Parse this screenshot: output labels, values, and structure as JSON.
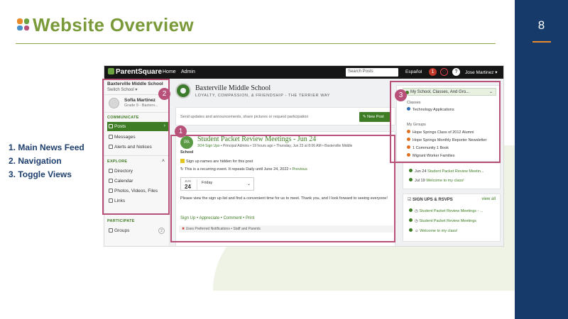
{
  "slide": {
    "title": "Website Overview",
    "page_number": "8",
    "legend": [
      "1. Main News Feed",
      "2. Navigation",
      "3. Toggle Views"
    ],
    "logo_colors": [
      "#e98a2b",
      "#6aa33f",
      "#4a90c8",
      "#b8517a"
    ],
    "accent_color": "#7a9a3a",
    "band_color": "#163b6a",
    "callout_color": "#b8517a",
    "callouts": [
      "1",
      "2",
      "3"
    ]
  },
  "app": {
    "brand": "ParentSquare",
    "nav": [
      "Home",
      "Admin"
    ],
    "search_placeholder": "Search Posts",
    "language": "Español",
    "notification_count": "1",
    "help_icon": "?",
    "user": "Jose Martinez ▾"
  },
  "sidebar": {
    "school": "Baxterville Middle School",
    "switch": "Switch School ▾",
    "student_name": "Sofia Martinez",
    "student_grade": "Grade 9 - Baxterv...",
    "communicate_label": "COMMUNICATE",
    "communicate_items": [
      "Posts",
      "Messages",
      "Alerts and Notices"
    ],
    "explore_label": "EXPLORE",
    "explore_items": [
      "Directory",
      "Calendar",
      "Photos, Videos, Files",
      "Links"
    ],
    "participate_label": "PARTICIPATE",
    "participate_items": [
      "Groups"
    ],
    "groups_count": "2",
    "collapse_icon": "˄"
  },
  "school": {
    "name": "Baxterville Middle School",
    "motto": "LOYALTY, COMPASSION, & FRIENDSHIP - THE TERRIER WAY"
  },
  "composer": {
    "placeholder": "Send updates and announcements, share pictures or request participation",
    "button": "New Post"
  },
  "post": {
    "avatar": "PA",
    "title": "Student Packet Review Meetings - Jun 24",
    "signups": "3/24 Sign Ups",
    "meta": " • Principal Admins • 19 hours ago • Thursday, Jun 23 at 8:06 AM • Baxterville Middle",
    "school": "School",
    "signup_note": "Sign up names are hidden for this post",
    "recurring": "This is a recurring event. It repeats Daily until June 24, 2022 • ",
    "previous": "Previous",
    "date_month": "JUN",
    "date_day": "24",
    "weekday": "Friday",
    "body": "Please view the sign up list and find a convenient time for us to meet. Thank you, and I look forward to seeing everyone!",
    "actions": "Sign Up • Appreciate • Comment • Print",
    "footer": "Uses Preferred Notifications • Staff and Parents"
  },
  "views": {
    "toggle": "My School, Classes, And Gro...",
    "classes_label": "Classes",
    "classes": [
      "Technology Applications"
    ],
    "groups_label": "My Groups",
    "groups": [
      "Hope Springs Class of 2012 Alumni",
      "Hope Springs Monthly Reporter Newsletter",
      "1 Community 1 Book",
      "Migrant Worker Families"
    ],
    "class_color": "#2f6db3",
    "group_color": "#e07020"
  },
  "events": {
    "items": [
      {
        "date": "Jun 24",
        "text": " Student Packet Review Meetin..."
      },
      {
        "date": "Jul 19",
        "text": " Welcome to my class!"
      }
    ]
  },
  "signups": {
    "title": "SIGN UPS & RSVPS",
    "view_all": "view all",
    "items": [
      "Student Packet Review Meetings - ...",
      "Student Packet Review Meetings",
      "Welcome to my class!"
    ]
  }
}
